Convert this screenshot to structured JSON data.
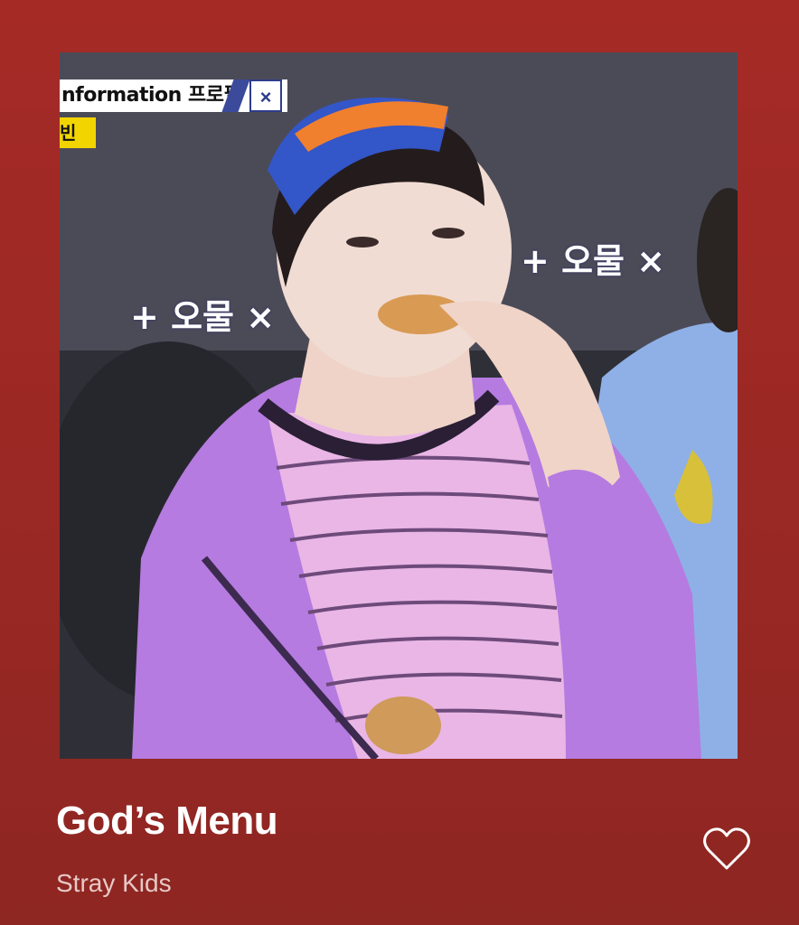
{
  "track": {
    "title": "God’s Menu",
    "artist": "Stray Kids"
  },
  "artwork": {
    "overlay_info": "nformation 프로필",
    "overlay_close": "×",
    "overlay_name": "빈",
    "caption_left": "+ 오물 ×",
    "caption_right": "+ 오물 ×"
  },
  "actions": {
    "like_icon": "heart-outline-icon"
  },
  "colors": {
    "background": "#9a2824",
    "title": "#ffffff",
    "artist": "#e6c9c6"
  }
}
